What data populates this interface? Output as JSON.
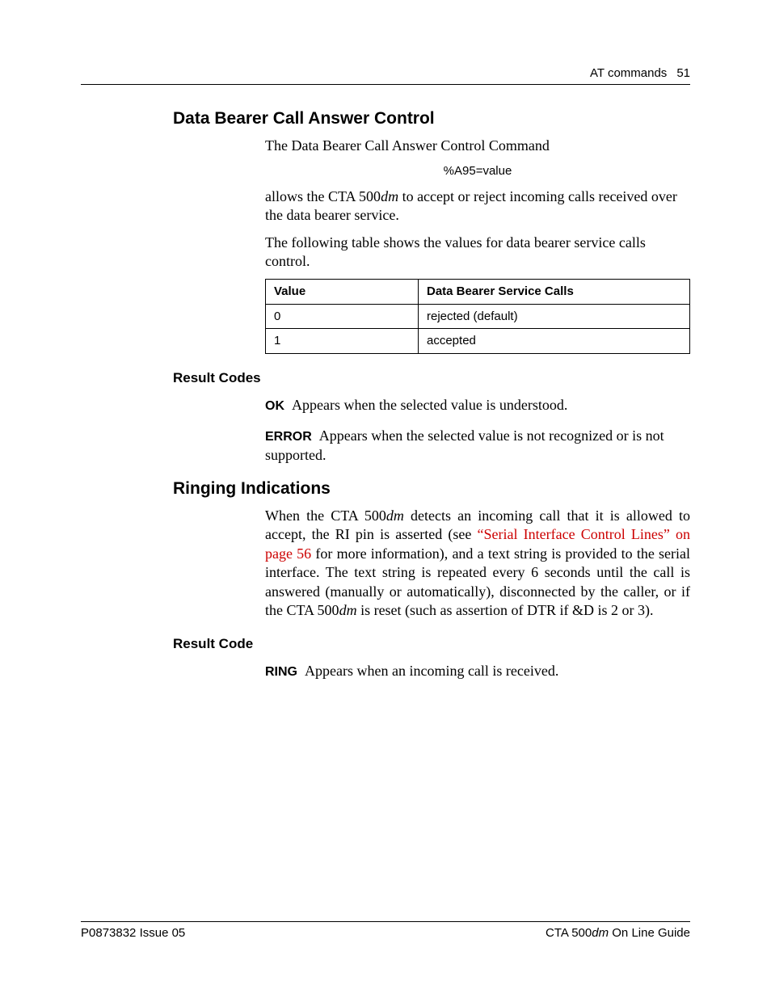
{
  "header": {
    "section": "AT commands",
    "page": "51"
  },
  "s1": {
    "heading": "Data Bearer Call Answer Control",
    "p1": "The Data Bearer Call Answer Control Command",
    "code": "%A95=value",
    "p2a": "allows the CTA 500",
    "p2b": "dm",
    "p2c": " to accept or reject incoming calls received over the data bearer service.",
    "p3": "The following table shows the values for data bearer service calls control.",
    "table": {
      "h1": "Value",
      "h2": "Data Bearer Service Calls",
      "rows": [
        {
          "v": "0",
          "d": "rejected (default)"
        },
        {
          "v": "1",
          "d": "accepted"
        }
      ]
    }
  },
  "rc1": {
    "heading": "Result Codes",
    "items": [
      {
        "label": "OK",
        "text": "Appears when the selected value is understood."
      },
      {
        "label": "ERROR",
        "text": "Appears when the selected value is not recognized or is not supported."
      }
    ]
  },
  "s2": {
    "heading": "Ringing Indications",
    "p1a": "When the CTA 500",
    "p1b": "dm",
    "p1c": " detects an incoming call that it is allowed to accept, the RI pin is asserted (see ",
    "link1": "“Serial Interface Control Lines” on page 56",
    "p1d": " for more information), and a text string is provided to the serial interface. The text string is repeated every 6 seconds until the call is answered (manually or automatically), disconnected by the caller, or if the CTA 500",
    "p1e": "dm",
    "p1f": " is reset (such as assertion of DTR if &D is 2 or 3)."
  },
  "rc2": {
    "heading": "Result Code",
    "items": [
      {
        "label": "RING",
        "text": "Appears when an incoming call is received."
      }
    ]
  },
  "footer": {
    "left": "P0873832  Issue 05",
    "right_a": "CTA 500",
    "right_b": "dm",
    "right_c": " On Line Guide"
  }
}
